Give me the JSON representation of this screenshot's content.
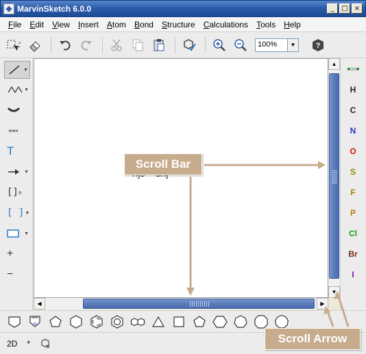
{
  "window": {
    "title": "MarvinSketch 6.0.0",
    "app_icon": "marvin-app-icon"
  },
  "window_controls": {
    "minimize": "_",
    "maximize": "□",
    "close": "×"
  },
  "menu": [
    {
      "label": "File",
      "ul": "F",
      "rest": "ile"
    },
    {
      "label": "Edit",
      "ul": "E",
      "rest": "dit"
    },
    {
      "label": "View",
      "ul": "V",
      "rest": "iew"
    },
    {
      "label": "Insert",
      "ul": "I",
      "rest": "nsert"
    },
    {
      "label": "Atom",
      "ul": "A",
      "rest": "tom"
    },
    {
      "label": "Bond",
      "ul": "B",
      "rest": "ond"
    },
    {
      "label": "Structure",
      "ul": "S",
      "rest": "tructure"
    },
    {
      "label": "Calculations",
      "ul": "C",
      "rest": "alculations"
    },
    {
      "label": "Tools",
      "ul": "T",
      "rest": "ools"
    },
    {
      "label": "Help",
      "ul": "H",
      "rest": "elp"
    }
  ],
  "toolbar": {
    "zoom_value": "100%"
  },
  "left_palette": {
    "text_tool": "T",
    "bracket_n_tool": "[]",
    "bracket_n_sub": "n",
    "bracket_tool": "[ ]",
    "plus_tool": "+",
    "minus_tool": "−"
  },
  "elements": [
    {
      "symbol": "H",
      "color": "#222222"
    },
    {
      "symbol": "C",
      "color": "#222222"
    },
    {
      "symbol": "N",
      "color": "#2a35c8"
    },
    {
      "symbol": "O",
      "color": "#e01010"
    },
    {
      "symbol": "S",
      "color": "#8a8a00"
    },
    {
      "symbol": "F",
      "color": "#b07a00"
    },
    {
      "symbol": "P",
      "color": "#c07a00"
    },
    {
      "symbol": "Cl",
      "color": "#1a9a1a"
    },
    {
      "symbol": "Br",
      "color": "#7a2a1a"
    },
    {
      "symbol": "I",
      "color": "#7a1aa8"
    }
  ],
  "molecule": {
    "left": "H",
    "left_sub": "3",
    "left_atom": "C",
    "bond": " — ",
    "right": "CH",
    "right_sub": "3"
  },
  "callouts": {
    "scroll_bar": "Scroll Bar",
    "scroll_arrow": "Scroll Arrow"
  },
  "status": {
    "mode": "2D",
    "star": "*"
  },
  "colors": {
    "callout": "#c7ab8d",
    "scrollbar_thumb": "#5a7bbc",
    "titlebar": "#2a5aa8"
  }
}
